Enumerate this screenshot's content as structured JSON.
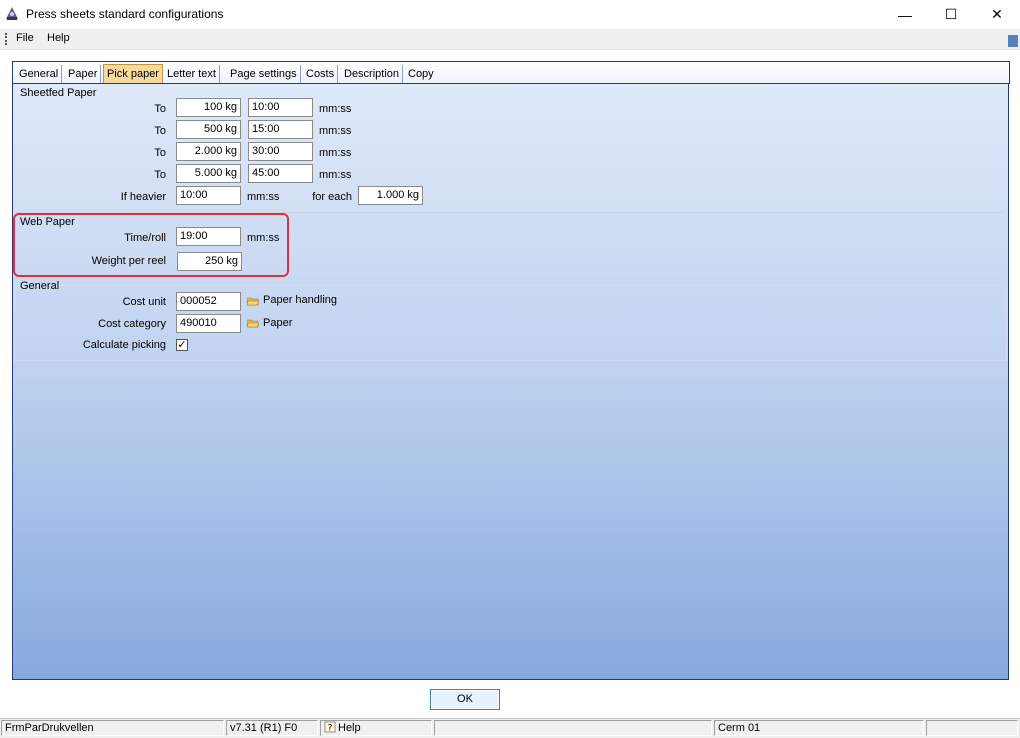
{
  "window": {
    "title": "Press sheets standard configurations",
    "controls": {
      "minimize": "—",
      "maximize": "☐",
      "close": "✕"
    }
  },
  "menu": {
    "file": "File",
    "help": "Help"
  },
  "tabs": [
    {
      "label": "General"
    },
    {
      "label": "Paper"
    },
    {
      "label": "Pick paper",
      "active": true
    },
    {
      "label": "Letter text"
    },
    {
      "label": "Page settings"
    },
    {
      "label": "Costs"
    },
    {
      "label": "Description"
    },
    {
      "label": "Copy"
    }
  ],
  "sheetfed": {
    "title": "Sheetfed Paper",
    "rows": [
      {
        "label": "To",
        "weight": "100 kg",
        "time": "10:00",
        "unit": "mm:ss"
      },
      {
        "label": "To",
        "weight": "500 kg",
        "time": "15:00",
        "unit": "mm:ss"
      },
      {
        "label": "To",
        "weight": "2.000 kg",
        "time": "30:00",
        "unit": "mm:ss"
      },
      {
        "label": "To",
        "weight": "5.000 kg",
        "time": "45:00",
        "unit": "mm:ss"
      }
    ],
    "heavier": {
      "label": "If heavier",
      "time": "10:00",
      "unit": "mm:ss",
      "for_each_label": "for each",
      "for_each_value": "1.000 kg"
    }
  },
  "web": {
    "title": "Web Paper",
    "time_roll_label": "Time/roll",
    "time_roll_value": "19:00",
    "time_roll_unit": "mm:ss",
    "weight_label": "Weight per reel",
    "weight_value": "250 kg"
  },
  "general": {
    "title": "General",
    "cost_unit_label": "Cost unit",
    "cost_unit_value": "000052",
    "cost_unit_desc": "Paper handling",
    "cost_category_label": "Cost category",
    "cost_category_value": "490010",
    "cost_category_desc": "Paper",
    "calc_picking_label": "Calculate picking",
    "calc_picking_checked": true,
    "check_mark": "✓"
  },
  "ok_label": "OK",
  "status": {
    "form": "FrmParDrukvellen",
    "version": "v7.31 (R1) F0",
    "help": "Help",
    "company": "Cerm 01"
  },
  "colors": {
    "accent": "#223a78",
    "highlight": "#e0303a",
    "active_tab": "#f7d9a0"
  }
}
